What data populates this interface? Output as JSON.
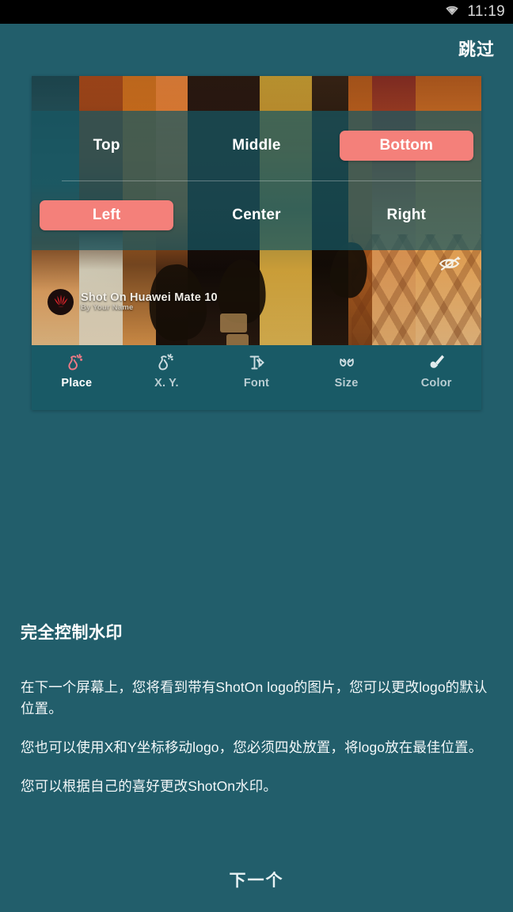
{
  "statusbar": {
    "time": "11:19",
    "wifi_icon": "wifi-icon",
    "background": "#000000",
    "text_color": "#d8d8d8"
  },
  "theme": {
    "background": "#225e6b",
    "accent": "#f4807a",
    "toolbar_background": "#195a66",
    "text": "#ffffff"
  },
  "header": {
    "skip_label": "跳过"
  },
  "preview": {
    "watermark": {
      "logo_icon": "huawei-logo-icon",
      "title": "Shot On Huawei Mate 10",
      "subtitle": "By Your Name"
    },
    "eye_toggle": {
      "icon": "eye-off-icon",
      "state": "hidden"
    },
    "placement": {
      "vertical": {
        "options": [
          "Top",
          "Middle",
          "Bottom"
        ],
        "selected": "Bottom"
      },
      "horizontal": {
        "options": [
          "Left",
          "Center",
          "Right"
        ],
        "selected": "Left"
      }
    },
    "toolbar": {
      "active": "Place",
      "items": [
        {
          "label": "Place",
          "icon": "wand-place-icon"
        },
        {
          "label": "X. Y.",
          "icon": "wand-sparkle-xy-icon"
        },
        {
          "label": "Font",
          "icon": "font-t-icon"
        },
        {
          "label": "Size",
          "icon": "size-arrows-icon"
        },
        {
          "label": "Color",
          "icon": "paintbrush-icon"
        }
      ]
    }
  },
  "main": {
    "title": "完全控制水印",
    "paragraphs": [
      "在下一个屏幕上，您将看到带有ShotOn logo的图片，您可以更改logo的默认位置。",
      "您也可以使用X和Y坐标移动logo，您必须四处放置，将logo放在最佳位置。",
      "您可以根据自己的喜好更改ShotOn水印。"
    ]
  },
  "footer": {
    "next_label": "下一个"
  }
}
